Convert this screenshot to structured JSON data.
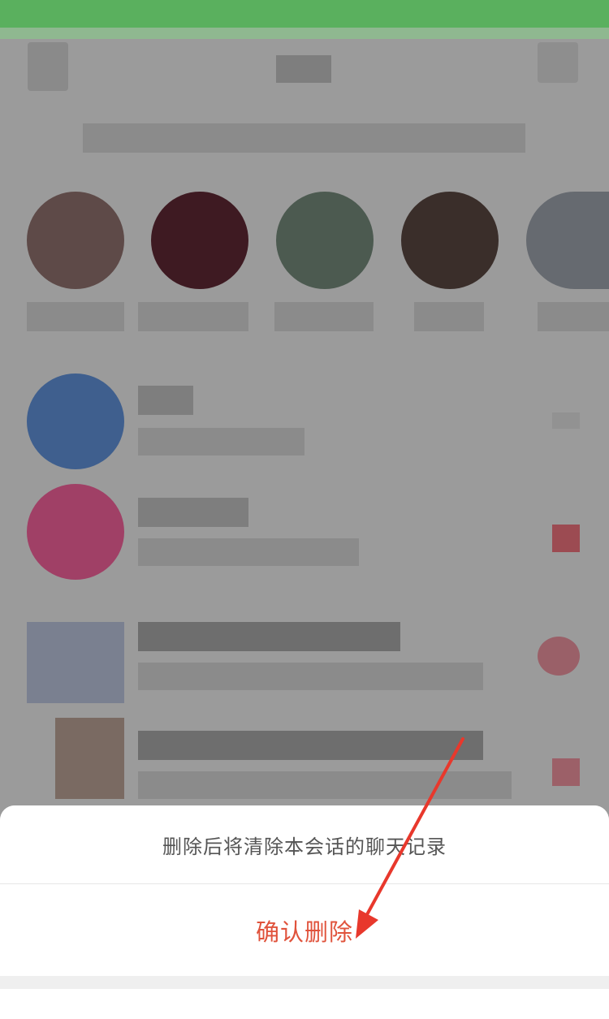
{
  "dialog": {
    "message": "删除后将清除本会话的聊天记录",
    "confirm_label": "确认删除"
  },
  "colors": {
    "status_bar": "#5ab05e",
    "confirm_text": "#e0533c",
    "annotation_arrow": "#e8382c"
  },
  "annotation": {
    "icon": "red-arrow-pointer"
  }
}
